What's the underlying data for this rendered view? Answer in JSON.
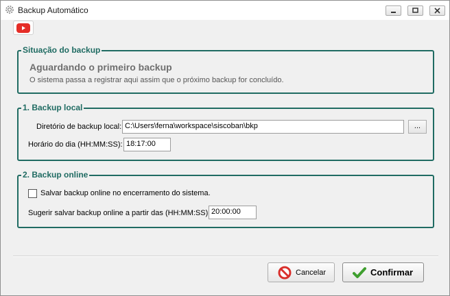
{
  "window": {
    "title": "Backup Automático",
    "icon": "gear-icon"
  },
  "toolbar": {
    "video_icon": "youtube-icon"
  },
  "status_group": {
    "title": "Situação do backup",
    "status": "Aguardando o primeiro backup",
    "description": "O sistema passa a registrar aqui assim que o próximo backup for concluído."
  },
  "local_group": {
    "title": "1. Backup local",
    "dir_label": "Diretório de backup local:",
    "dir_value": "C:\\Users\\ferna\\workspace\\siscoban\\bkp",
    "browse_label": "...",
    "time_label": "Horário do dia (HH:MM:SS):",
    "time_value": "18:17:00"
  },
  "online_group": {
    "title": "2. Backup online",
    "checkbox_label": "Salvar backup online no encerramento do sistema.",
    "checkbox_checked": false,
    "suggest_label": "Sugerir salvar backup online a partir das (HH:MM:SS):",
    "suggest_value": "20:00:00"
  },
  "buttons": {
    "cancel": "Cancelar",
    "confirm": "Confirmar"
  },
  "colors": {
    "group_border": "#1f6b62",
    "group_title": "#1f6b62",
    "youtube_red": "#e52d27",
    "cancel_red": "#d9302c",
    "confirm_green": "#3f9f2f"
  }
}
